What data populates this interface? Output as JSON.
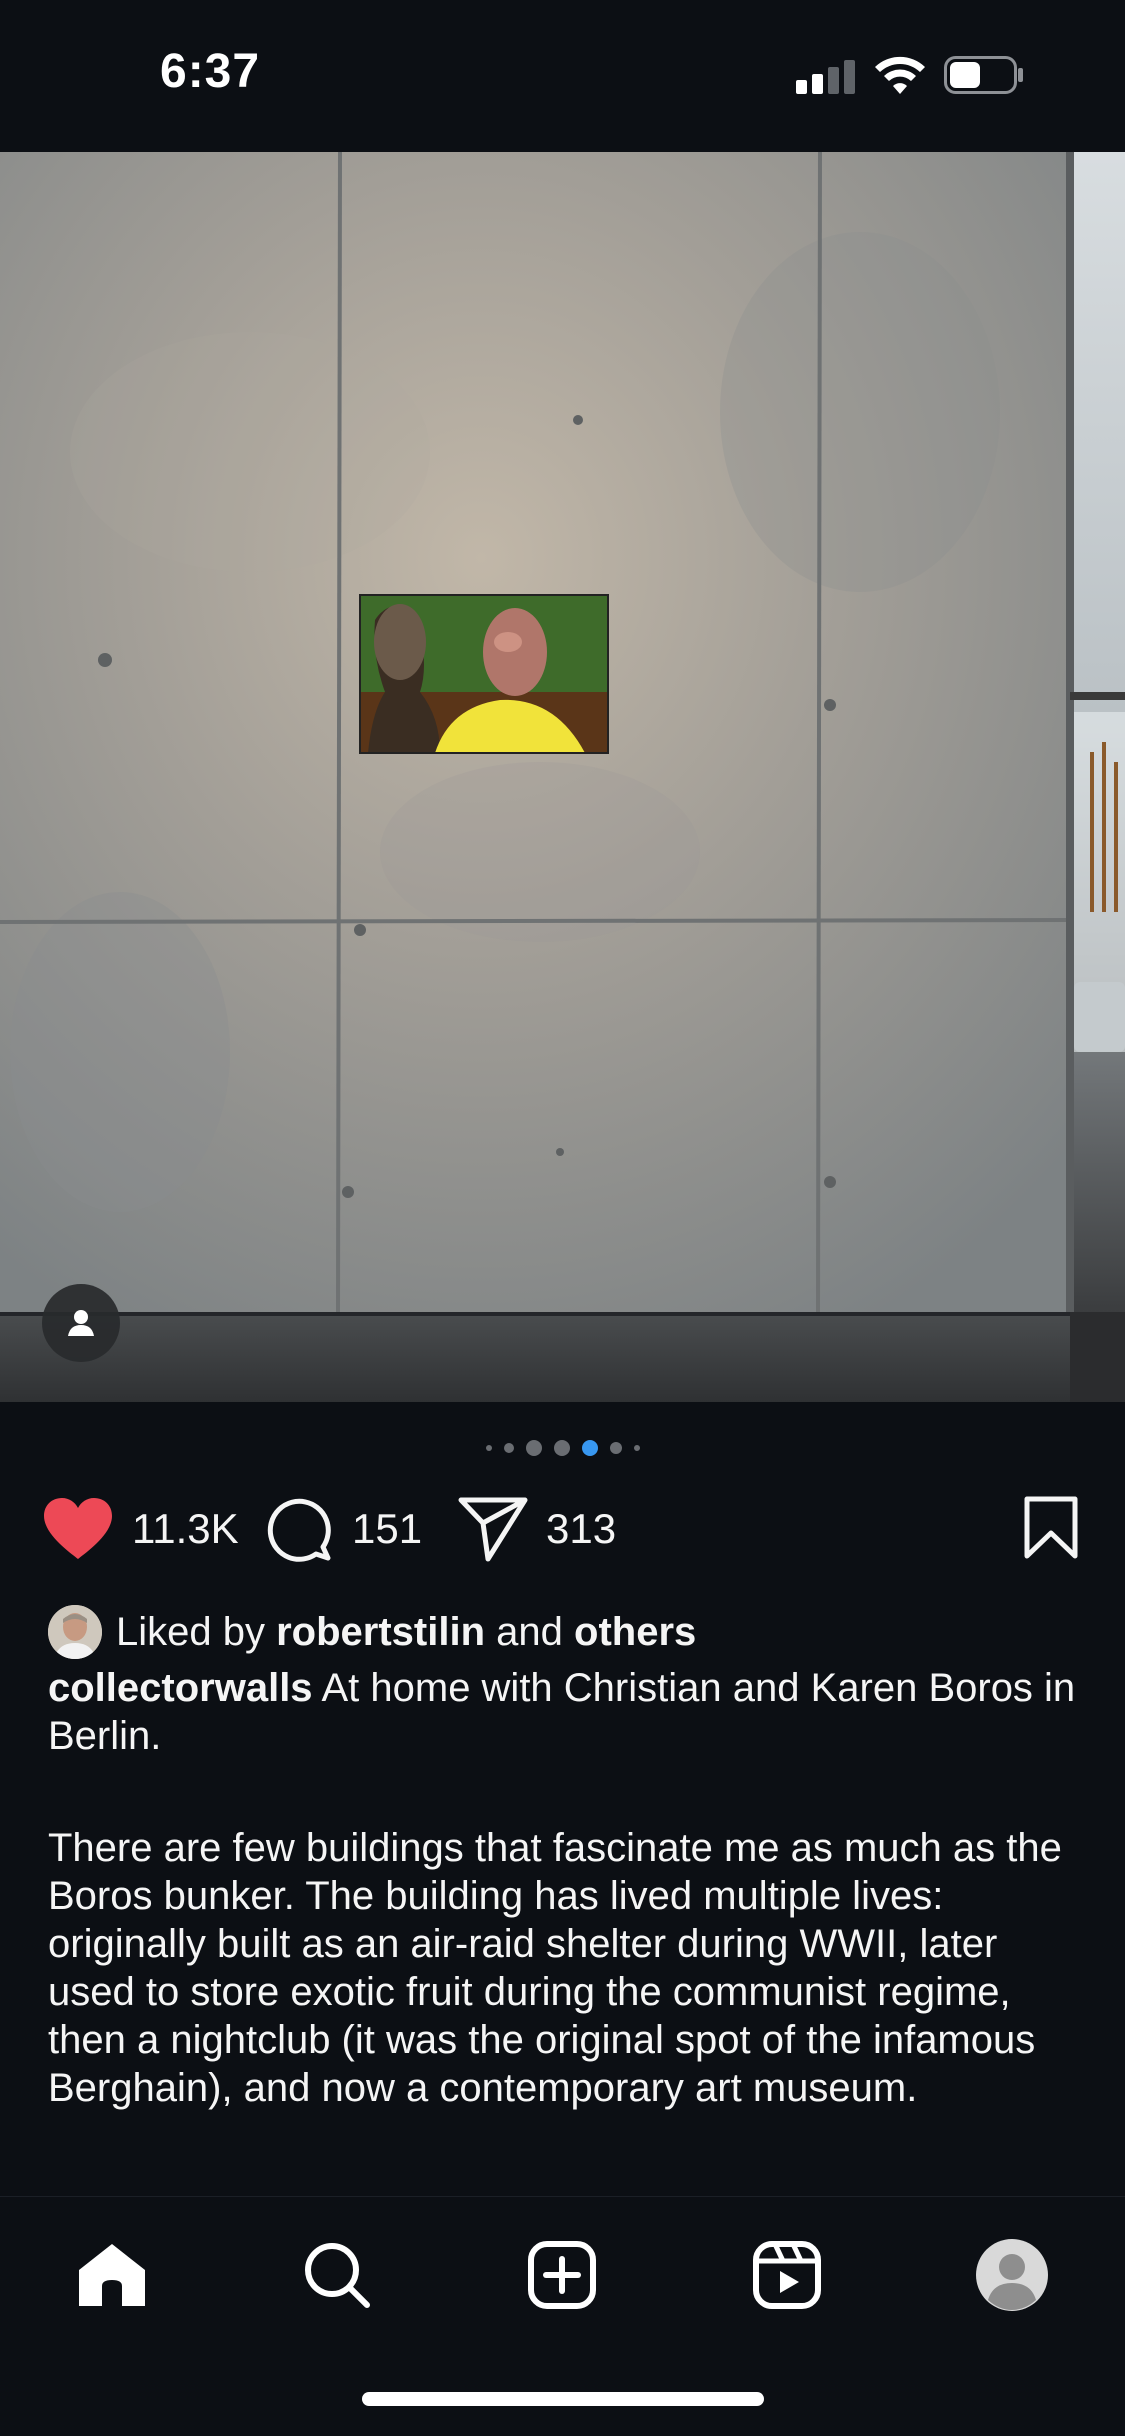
{
  "status_bar": {
    "time": "6:37",
    "icons": [
      "cellular-signal-icon",
      "wifi-icon",
      "battery-icon"
    ]
  },
  "post": {
    "image_description_icon": "user-tag-icon",
    "carousel": {
      "total_dots": 7,
      "active_index": 4
    },
    "actions": {
      "likes": "11.3K",
      "comments": "151",
      "shares": "313",
      "like_color": "#ed4956"
    },
    "liked_by": {
      "prefix": "Liked by",
      "user": "robertstilin",
      "connector": "and",
      "others": "others"
    },
    "caption": {
      "username": "collectorwalls",
      "headline": "At home with Christian and Karen Boros in Berlin.",
      "body": "There are few buildings that fascinate me as much as the Boros bunker. The building has lived multiple lives: originally built as an air-raid shelter during WWII, later used to store exotic fruit during the communist regime, then a nightclub (it was the original spot of the infamous Berghain), and now a contemporary art museum."
    }
  },
  "tab_bar": {
    "items": [
      "home-icon",
      "search-icon",
      "create-icon",
      "reels-icon",
      "profile-icon"
    ],
    "active": "home-icon"
  },
  "colors": {
    "background": "#0c0f14",
    "accent_dot": "#3897f0",
    "text": "#f5f5f5"
  }
}
